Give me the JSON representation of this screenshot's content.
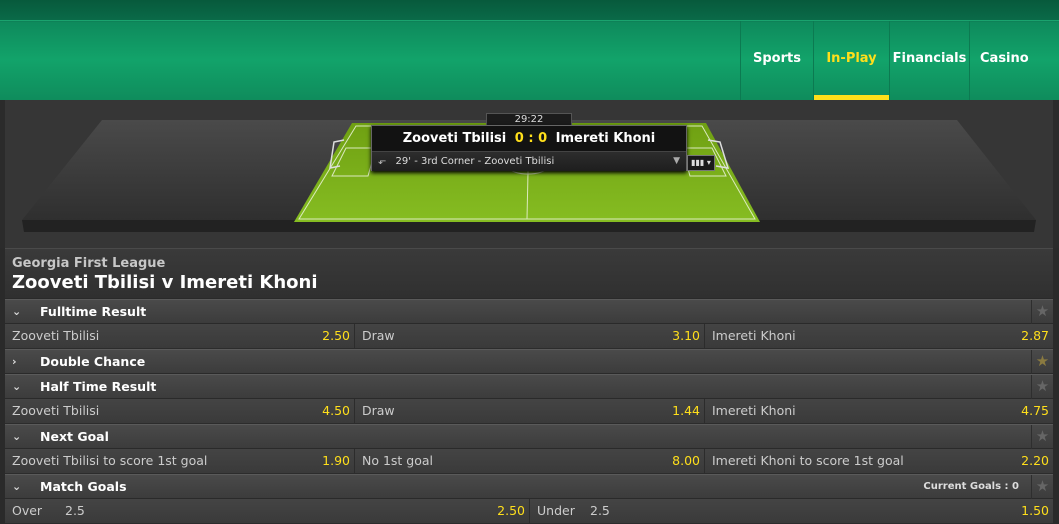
{
  "nav": {
    "items": [
      {
        "label": "Sports"
      },
      {
        "label": "In-Play"
      },
      {
        "label": "Financials"
      },
      {
        "label": "Casino"
      }
    ]
  },
  "match": {
    "clock": "29:22",
    "home": "Zooveti Tbilisi",
    "away": "Imereti Khoni",
    "home_score": "0",
    "separator": ":",
    "away_score": "0",
    "event": "29' - 3rd Corner - Zooveti Tbilisi"
  },
  "event_header": {
    "league": "Georgia First League",
    "title": "Zooveti Tbilisi v Imereti Khoni"
  },
  "markets": {
    "fulltime": {
      "name": "Fulltime Result",
      "home": {
        "label": "Zooveti Tbilisi",
        "price": "2.50"
      },
      "draw": {
        "label": "Draw",
        "price": "3.10"
      },
      "away": {
        "label": "Imereti Khoni",
        "price": "2.87"
      }
    },
    "double_chance": {
      "name": "Double Chance"
    },
    "halftime": {
      "name": "Half Time Result",
      "home": {
        "label": "Zooveti Tbilisi",
        "price": "4.50"
      },
      "draw": {
        "label": "Draw",
        "price": "1.44"
      },
      "away": {
        "label": "Imereti Khoni",
        "price": "4.75"
      }
    },
    "next_goal": {
      "name": "Next Goal",
      "home": {
        "label": "Zooveti Tbilisi to score 1st goal",
        "price": "1.90"
      },
      "none": {
        "label": "No 1st goal",
        "price": "8.00"
      },
      "away": {
        "label": "Imereti Khoni to score 1st goal",
        "price": "2.20"
      }
    },
    "match_goals": {
      "name": "Match Goals",
      "current": "Current Goals : 0",
      "over": {
        "label": "Over",
        "line": "2.5",
        "price": "2.50"
      },
      "under": {
        "label": "Under",
        "line": "2.5",
        "price": "1.50"
      }
    }
  },
  "colors": {
    "brand_green": "#12a36a",
    "accent_yellow": "#ffdf1b",
    "pitch_green": "#7fb21c"
  }
}
